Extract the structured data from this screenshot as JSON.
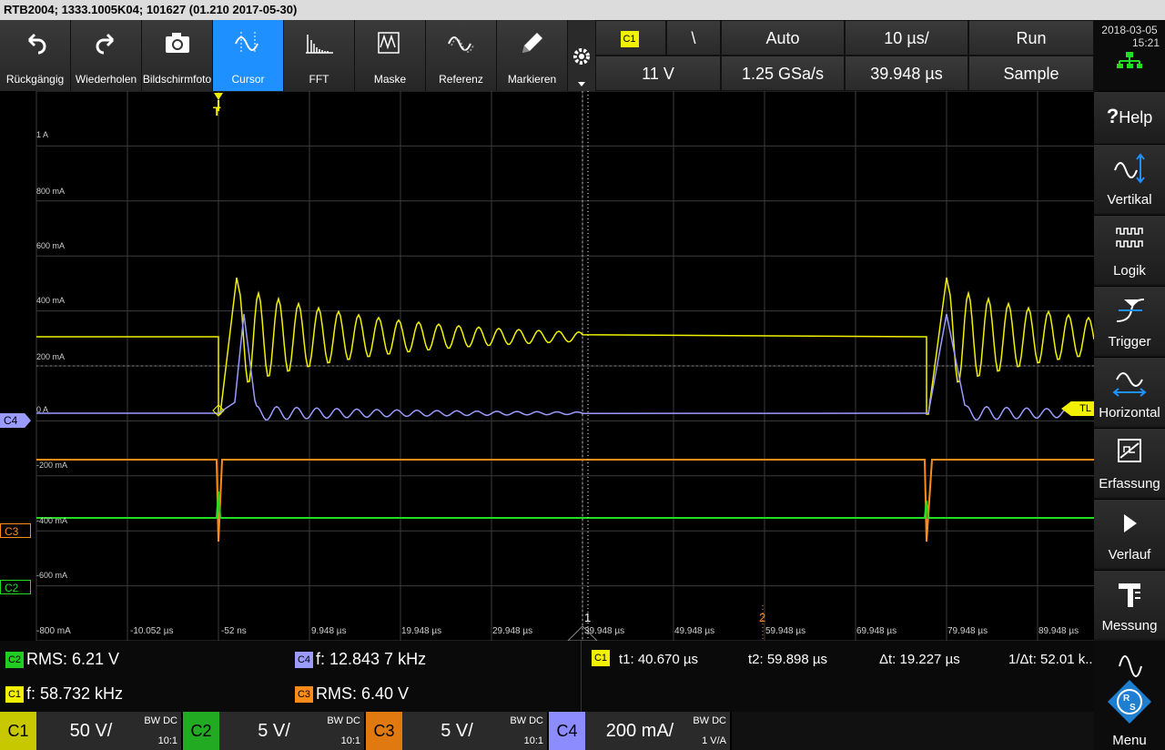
{
  "title": "RTB2004; 1333.1005K04; 101627 (01.210 2017-05-30)",
  "toolbar": [
    {
      "label": "Rückgängig",
      "icon": "undo-icon"
    },
    {
      "label": "Wiederholen",
      "icon": "redo-icon"
    },
    {
      "label": "Bildschirmfoto",
      "icon": "camera-icon"
    },
    {
      "label": "Cursor",
      "icon": "cursor-wave-icon"
    },
    {
      "label": "FFT",
      "icon": "fft-icon"
    },
    {
      "label": "Maske",
      "icon": "mask-icon"
    },
    {
      "label": "Referenz",
      "icon": "reference-icon"
    },
    {
      "label": "Markieren",
      "icon": "pencil-icon"
    }
  ],
  "trigger": {
    "source": "C1",
    "slope": "\\",
    "level": "11 V"
  },
  "acq": {
    "mode": "Auto",
    "sample_rate": "1.25 GSa/s",
    "timebase": "10 µs/",
    "position": "39.948 µs",
    "run": "Run",
    "acq_mode": "Sample"
  },
  "clock": {
    "date": "2018-03-05",
    "time": "15:21"
  },
  "side_menu": [
    "Help",
    "Vertikal",
    "Logik",
    "Trigger",
    "Horizontal",
    "Erfassung",
    "Verlauf",
    "Messung",
    "Menu"
  ],
  "help_prefix": "?",
  "y_labels": [
    "1 A",
    "800 mA",
    "600 mA",
    "400 mA",
    "200 mA",
    "0 A",
    "-200 mA",
    "-400 mA",
    "-600 mA",
    "-800 mA"
  ],
  "x_labels": [
    "-10.052 µs",
    "-52 ns",
    "9.948 µs",
    "19.948 µs",
    "29.948 µs",
    "39.948 µs",
    "49.948 µs",
    "59.948 µs",
    "69.948 µs",
    "79.948 µs",
    "89.948 µs"
  ],
  "trig_marker": "T",
  "tl_label": "TL",
  "cursor_labels": [
    "1",
    "2"
  ],
  "channel_tags": {
    "c4": "C4",
    "c3": "C3",
    "c2": "C2"
  },
  "measurements": [
    {
      "ch": "C2",
      "text": "RMS: 6.21 V",
      "color": "#22cc22"
    },
    {
      "ch": "C4",
      "text": "f: 12.843 7 kHz",
      "color": "#9b9bff"
    },
    {
      "ch": "C1",
      "text": "f: 58.732 kHz",
      "color": "#f2f200"
    },
    {
      "ch": "C3",
      "text": "RMS: 6.40 V",
      "color": "#ff8c1a"
    }
  ],
  "cursor_meas": {
    "ch": "C1",
    "t1": "t1: 40.670 µs",
    "t2": "t2: 59.898 µs",
    "dt": "Δt: 19.227 µs",
    "inv": "1/Δt: 52.01 k.."
  },
  "channels": [
    {
      "name": "C1",
      "scale": "50 V/",
      "bw": "BW DC",
      "probe": "10:1",
      "color": "#c8c800"
    },
    {
      "name": "C2",
      "scale": "5 V/",
      "bw": "BW DC",
      "probe": "10:1",
      "color": "#22aa22"
    },
    {
      "name": "C3",
      "scale": "5 V/",
      "bw": "BW DC",
      "probe": "10:1",
      "color": "#e07a10"
    },
    {
      "name": "C4",
      "scale": "200 mA/",
      "bw": "BW DC",
      "probe": "1 V/A",
      "color": "#8c8cff"
    }
  ],
  "colors": {
    "c1": "#f2f200",
    "c2": "#22dd22",
    "c3": "#ff8c1a",
    "c4": "#9b9bff",
    "active": "#1e90ff"
  }
}
